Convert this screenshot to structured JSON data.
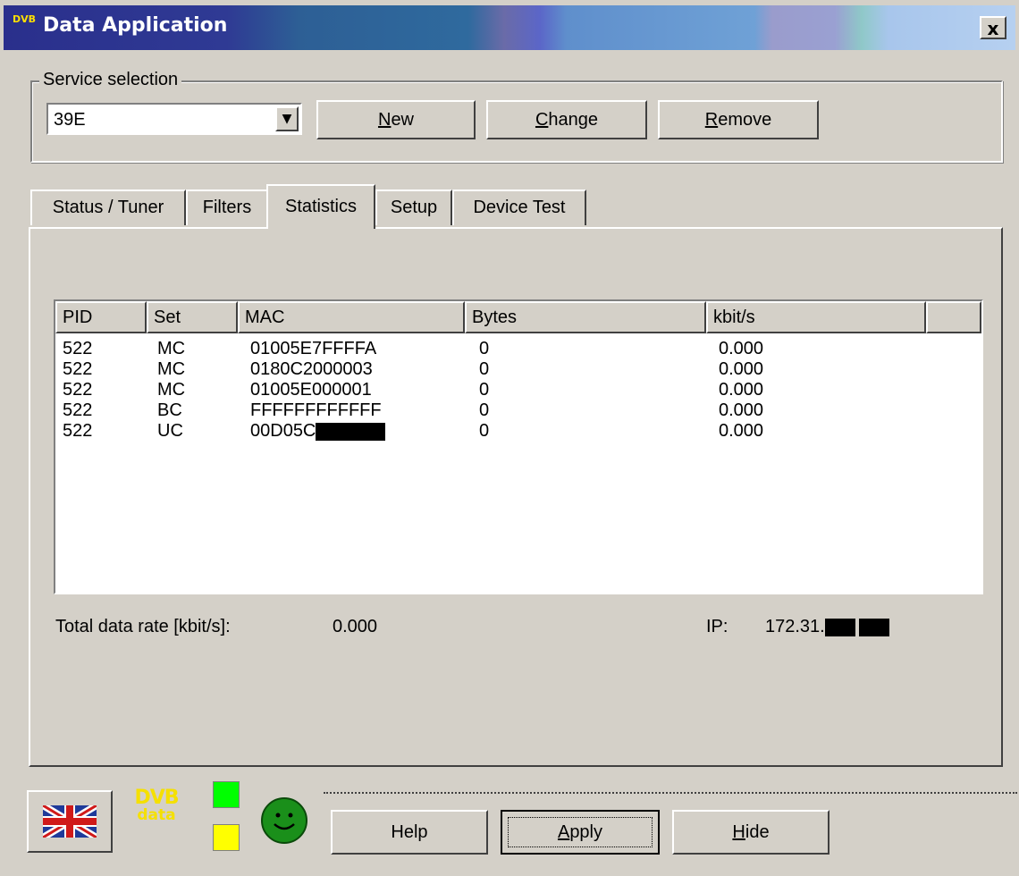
{
  "window": {
    "title": "Data Application",
    "logo_text": "DVB",
    "close_label": "x"
  },
  "service_selection": {
    "legend": "Service selection",
    "selected_value": "39E",
    "buttons": [
      {
        "label": "New",
        "accel": "N",
        "rest": "ew"
      },
      {
        "label": "Change",
        "accel": "C",
        "rest": "hange"
      },
      {
        "label": "Remove",
        "accel": "R",
        "rest": "emove"
      }
    ]
  },
  "tabs": [
    {
      "label": "Status / Tuner",
      "active": false
    },
    {
      "label": "Filters",
      "active": false
    },
    {
      "label": "Statistics",
      "active": true
    },
    {
      "label": "Setup",
      "active": false
    },
    {
      "label": "Device Test",
      "active": false
    }
  ],
  "statistics": {
    "columns": [
      "PID",
      "Set",
      "MAC",
      "Bytes",
      "kbit/s"
    ],
    "rows": [
      {
        "pid": "522",
        "set": "MC",
        "mac": "01005E7FFFFA",
        "bytes": "0",
        "kbits": "0.000"
      },
      {
        "pid": "522",
        "set": "MC",
        "mac": "0180C2000003",
        "bytes": "0",
        "kbits": "0.000"
      },
      {
        "pid": "522",
        "set": "MC",
        "mac": "01005E000001",
        "bytes": "0",
        "kbits": "0.000"
      },
      {
        "pid": "522",
        "set": "BC",
        "mac": "FFFFFFFFFFFF",
        "bytes": "0",
        "kbits": "0.000"
      },
      {
        "pid": "522",
        "set": "UC",
        "mac": "00D05C",
        "bytes": "0",
        "kbits": "0.000"
      }
    ],
    "total_label": "Total data rate [kbit/s]:",
    "total_value": "0.000",
    "ip_label": "IP:",
    "ip_value": "172.31."
  },
  "footer": {
    "logo_top": "DVB",
    "logo_bottom": "data",
    "buttons": [
      {
        "label": "Help"
      },
      {
        "label": "Apply",
        "accel": "A",
        "rest": "pply"
      },
      {
        "label": "Hide",
        "accel": "H",
        "rest": "ide"
      }
    ],
    "colors": {
      "led_top": "#00ff00",
      "led_bottom": "#ffff00",
      "status": "#1a8f1a"
    }
  }
}
